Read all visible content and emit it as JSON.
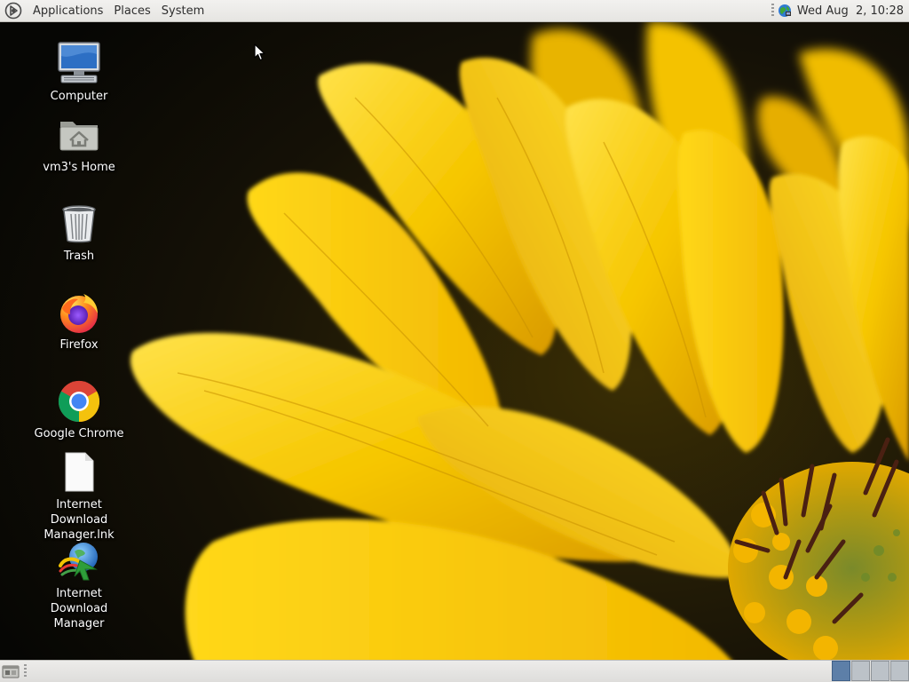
{
  "top_panel": {
    "menus": [
      "Applications",
      "Places",
      "System"
    ],
    "clock": "Wed Aug  2, 10:28"
  },
  "desktop": {
    "icons": [
      {
        "label": "Computer",
        "icon": "computer-icon"
      },
      {
        "label": "vm3's Home",
        "icon": "home-folder-icon"
      },
      {
        "label": "Trash",
        "icon": "trash-icon"
      },
      {
        "label": "Firefox",
        "icon": "firefox-icon"
      },
      {
        "label": "Google Chrome",
        "icon": "chrome-icon"
      },
      {
        "label": "Internet Download Manager.lnk",
        "icon": "file-icon"
      },
      {
        "label": "Internet Download Manager",
        "icon": "idm-icon"
      }
    ]
  },
  "bottom_panel": {
    "workspaces": 4,
    "active_workspace": 1
  },
  "colors": {
    "panel_bg": "#e9e8e6",
    "workspace_active": "#5d7fa8",
    "wallpaper_yellow": "#f5c400"
  }
}
